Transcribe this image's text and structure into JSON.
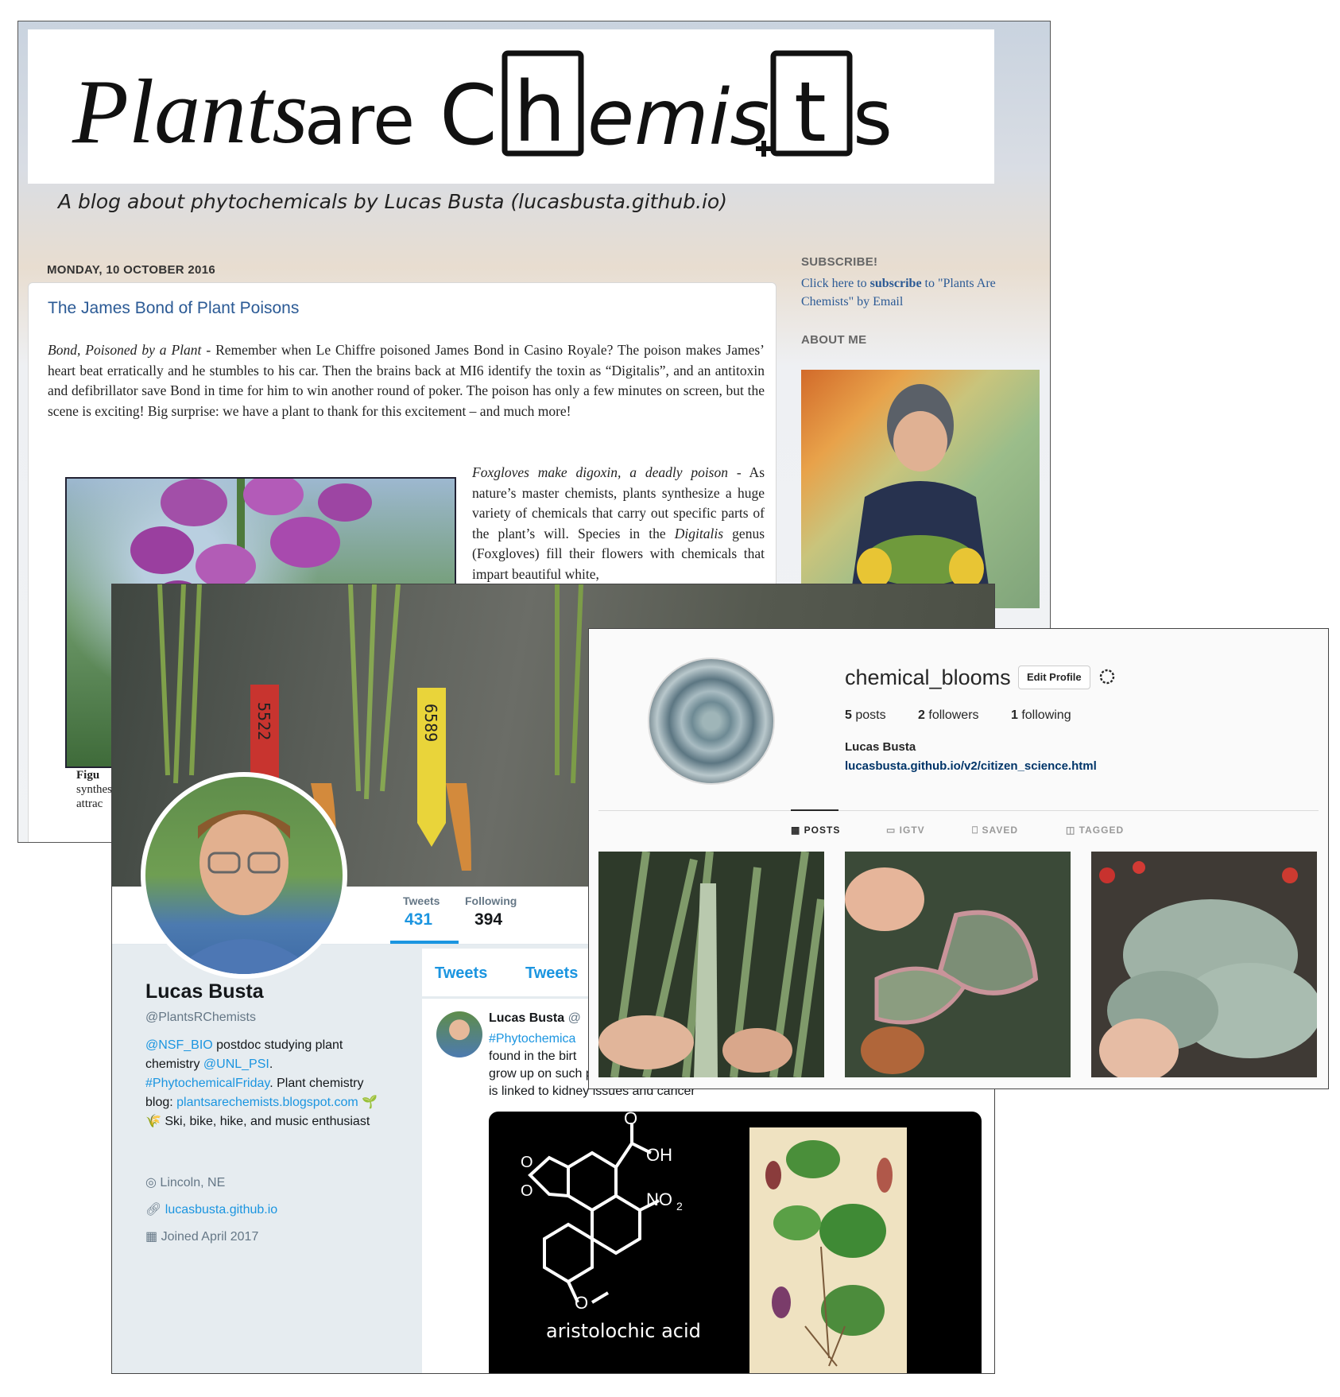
{
  "blog": {
    "logo_text_left": "Plants",
    "logo_text_mid": "are",
    "logo_letters": [
      "C",
      "h",
      "emis",
      "t",
      "s"
    ],
    "tagline": "A blog about phytochemicals by Lucas Busta (lucasbusta.github.io)",
    "date": "MONDAY, 10 OCTOBER 2016",
    "post_title": "The James Bond of Plant Poisons",
    "para1_lead": "Bond, Poisoned by a Plant",
    "para1": " - Remember when Le Chiffre poisoned James Bond in Casino Royale? The poison makes James’ heart beat erratically and he stumbles to his car. Then the brains back at MI6 identify the toxin as “Digitalis”, and an antitoxin and defibrillator save Bond in time for him to win another round of poker. The poison has only a few minutes on screen, but the scene is exciting! Big surprise: we have a plant to thank for this excitement – and much more!",
    "para2_lead": "Foxgloves make digoxin, a deadly poison",
    "para2_a": " - As nature’s master chemists, plants synthesize a huge variety of chemicals that carry out specific parts of the plant’s will. Species in the ",
    "para2_italic": "Digitalis",
    "para2_b": " genus (Foxgloves) fill their flowers with chemicals that impart beautiful white,",
    "fig_caption_lines": [
      "Figu",
      "synthes",
      "attrac"
    ],
    "subscribe_heading": "SUBSCRIBE!",
    "subscribe_pre": "Click here to ",
    "subscribe_bold": "subscribe",
    "subscribe_post": " to \"Plants Are Chemists\" by Email",
    "about_heading": "ABOUT ME"
  },
  "twitter": {
    "tag_left": "5522",
    "tag_right": "6589",
    "tweets_label": "Tweets",
    "tweets_count": "431",
    "following_label": "Following",
    "following_count": "394",
    "name": "Lucas Busta",
    "handle": "@PlantsRChemists",
    "bio_link1": "@NSF_BIO",
    "bio_text1": " postdoc studying plant chemistry ",
    "bio_link2": "@UNL_PSI",
    "bio_text2": ".",
    "bio_link3": "#PhytochemicalFriday",
    "bio_text3": ". Plant chemistry blog: ",
    "bio_link4": "plantsarechemists.blogspot.com",
    "bio_emoji": "🌱🌾",
    "bio_text4": " Ski, bike, hike, and music enthusiast",
    "location": "Lincoln, NE",
    "website": "lucasbusta.github.io",
    "joined": "Joined April 2017",
    "tab1": "Tweets",
    "tab2": "Tweets",
    "tweet_name": "Lucas Busta",
    "tweet_handle_partial": "@",
    "tweet_hashtag": "#Phytochemica",
    "tweet_line2": "found in the birt",
    "tweet_line3": "grow up on such plants. Birthworts are used in traditional medicine, but the acid",
    "tweet_line4": "is linked to kidney issues and cancer",
    "molecule_label": "aristolochic acid",
    "mol_oh": "OH",
    "mol_no2": "NO",
    "mol_no2_sub": "2",
    "mol_o": "O"
  },
  "instagram": {
    "username": "chemical_blooms",
    "edit_button": "Edit Profile",
    "posts_count": "5",
    "posts_label": " posts",
    "followers_count": "2",
    "followers_label": " followers",
    "following_count": "1",
    "following_label": " following",
    "full_name": "Lucas Busta",
    "website": "lucasbusta.github.io/v2/citizen_science.html",
    "tab_posts": "POSTS",
    "tab_igtv": "IGTV",
    "tab_saved": "SAVED",
    "tab_tagged": "TAGGED"
  }
}
